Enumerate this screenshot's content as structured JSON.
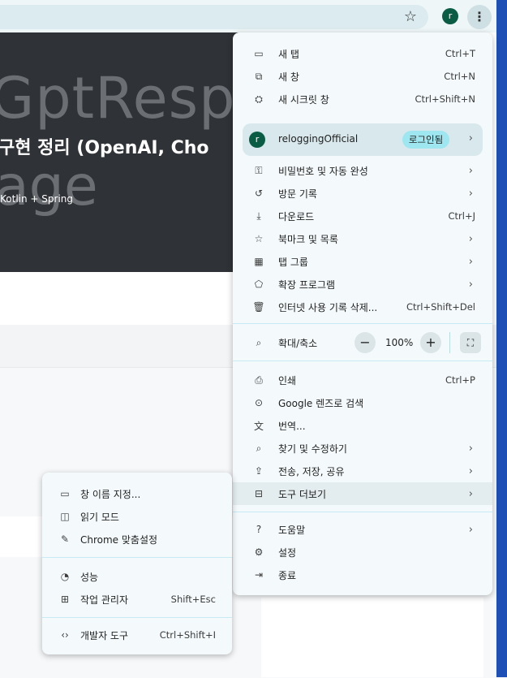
{
  "browser": {
    "profile_initial": "r",
    "star_icon": "star-icon",
    "menu_icon": "kebab-icon"
  },
  "page": {
    "hero_big_line1": "GptRespo",
    "hero_title": "구현 정리 (OpenAI, Cho",
    "hero_subtitle": "Kotlin + Spring",
    "hero_big_line2": "age"
  },
  "menu": {
    "new_tab": {
      "label": "새 탭",
      "shortcut": "Ctrl+T"
    },
    "new_window": {
      "label": "새 창",
      "shortcut": "Ctrl+N"
    },
    "incognito": {
      "label": "새 시크릿 창",
      "shortcut": "Ctrl+Shift+N"
    },
    "profile": {
      "initial": "r",
      "name": "reloggingOfficial",
      "badge": "로그인됨"
    },
    "passwords": {
      "label": "비밀번호 및 자동 완성"
    },
    "history": {
      "label": "방문 기록"
    },
    "downloads": {
      "label": "다운로드",
      "shortcut": "Ctrl+J"
    },
    "bookmarks": {
      "label": "북마크 및 목록"
    },
    "tab_groups": {
      "label": "탭 그룹"
    },
    "extensions": {
      "label": "확장 프로그램"
    },
    "clear_data": {
      "label": "인터넷 사용 기록 삭제...",
      "shortcut": "Ctrl+Shift+Del"
    },
    "zoom": {
      "label": "확대/축소",
      "minus": "−",
      "value": "100%",
      "plus": "+"
    },
    "print": {
      "label": "인쇄",
      "shortcut": "Ctrl+P"
    },
    "lens": {
      "label": "Google 렌즈로 검색"
    },
    "translate": {
      "label": "번역..."
    },
    "find": {
      "label": "찾기 및 수정하기"
    },
    "cast": {
      "label": "전송, 저장, 공유"
    },
    "more_tools": {
      "label": "도구 더보기"
    },
    "help": {
      "label": "도움말"
    },
    "settings": {
      "label": "설정"
    },
    "exit": {
      "label": "종료"
    }
  },
  "submenu": {
    "name_window": {
      "label": "창 이름 지정..."
    },
    "reading_mode": {
      "label": "읽기 모드"
    },
    "customize": {
      "label": "Chrome 맞춤설정"
    },
    "performance": {
      "label": "성능"
    },
    "task_manager": {
      "label": "작업 관리자",
      "shortcut": "Shift+Esc"
    },
    "devtools": {
      "label": "개발자 도구",
      "shortcut": "Ctrl+Shift+I"
    }
  }
}
